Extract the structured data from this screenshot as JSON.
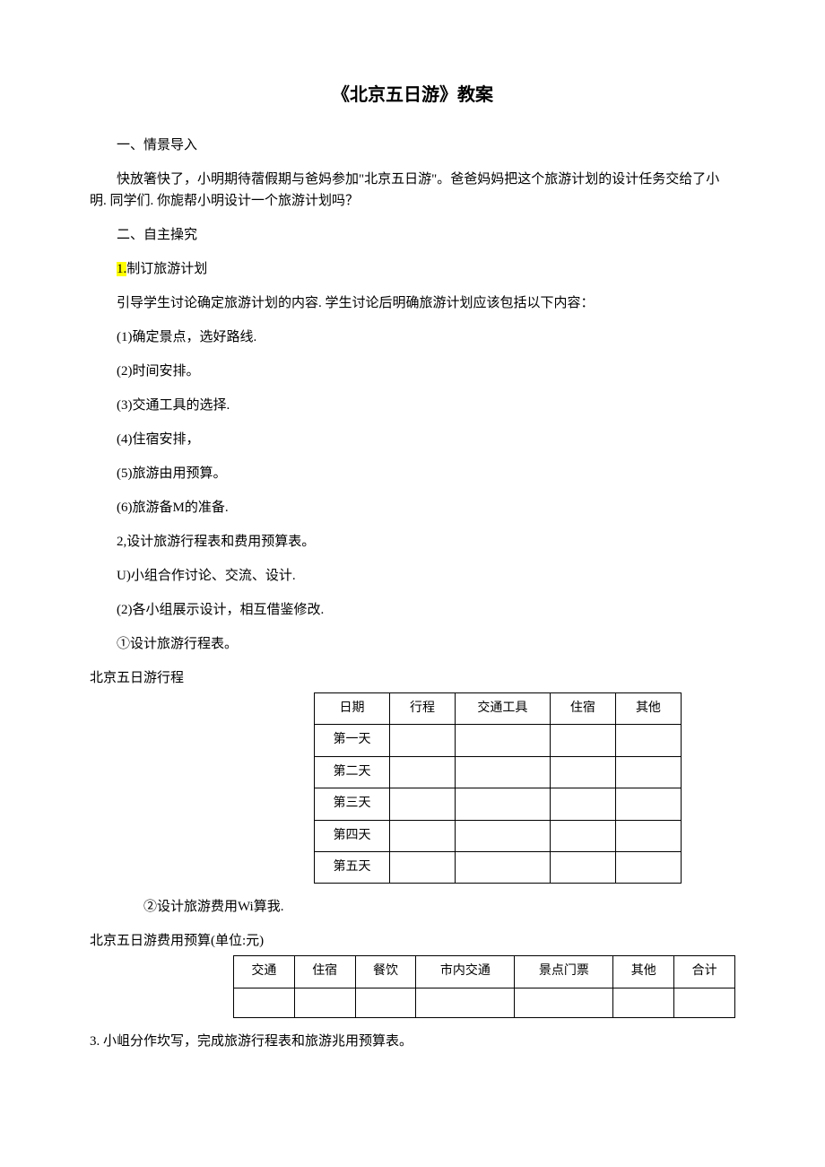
{
  "title": "《北京五日游》教案",
  "sections": {
    "s1_heading": "一、情景导入",
    "s1_p1": "快放箸快了，小明期待蓿假期与爸妈参加\"北京五日游\"。爸爸妈妈把这个旅游计划的设计任务交给了小明. 同学们. 你旎帮小明设计一个旅游计划吗？",
    "s2_heading": "二、自主操究",
    "s2_item1_num": "1.",
    "s2_item1_text": "制订旅游计划",
    "s2_item1_p": "引导学生讨论确定旅游计划的内容. 学生讨论后明确旅游计划应该包括以下内容：",
    "s2_list": [
      "(1)确定景点，选好路线.",
      "(2)时间安排。",
      "(3)交通工具的选择.",
      "(4)住宿安排，",
      "(5)旅游由用预算。",
      "(6)旅游备M的准备."
    ],
    "s2_item2": "2,设计旅游行程表和费用预算表。",
    "s2_item2_u": "U)小组合作讨论、交流、设计.",
    "s2_item2_2": "(2)各小组展示设计，相互借鉴修改.",
    "s2_design1": "①设计旅游行程表。",
    "table1_caption": "北京五日游行程",
    "itinerary": {
      "headers": [
        "日期",
        "行程",
        "交通工具",
        "住宿",
        "其他"
      ],
      "rows": [
        "第一天",
        "第二天",
        "第三天",
        "第四天",
        "第五天"
      ]
    },
    "s2_design2": "②设计旅游费用Wi算我.",
    "table2_caption": "北京五日游费用预算(单位:元)",
    "budget": {
      "headers": [
        "交通",
        "住宿",
        "餐饮",
        "市内交通",
        "景点门票",
        "其他",
        "合计"
      ]
    },
    "s3": "3. 小岨分作坎写，完成旅游行程表和旅游兆用预算表。"
  }
}
